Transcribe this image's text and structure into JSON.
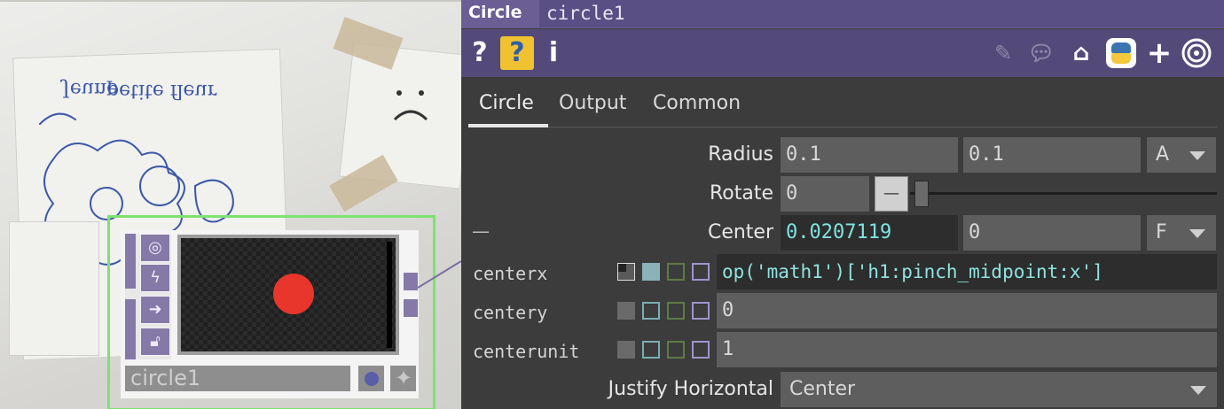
{
  "network": {
    "node": {
      "name": "circle1",
      "wire_color": "#7de26f",
      "dot_color": "#e8362c"
    },
    "sketch_text": [
      "petite fleur",
      "Jeune"
    ]
  },
  "panel": {
    "op_type": "Circle",
    "op_name": "circle1",
    "toolbar": {
      "help": "?",
      "python_help": "?",
      "info": "i",
      "icons_right": [
        "pencil-icon",
        "comment-icon",
        "clipboard-icon",
        "python-icon",
        "plus-icon",
        "target-icon"
      ]
    },
    "tabs": [
      {
        "label": "Circle",
        "active": true
      },
      {
        "label": "Output",
        "active": false
      },
      {
        "label": "Common",
        "active": false
      }
    ],
    "params": {
      "radius": {
        "label": "Radius",
        "x": "0.1",
        "y": "0.1",
        "unit": "A"
      },
      "rotate": {
        "label": "Rotate",
        "value": "0",
        "slider_button": "—"
      },
      "center": {
        "label": "Center",
        "x": "0.0207119",
        "y": "0",
        "unit": "F",
        "collapse": "—"
      },
      "centerx": {
        "label": "centerx",
        "expr": "op('math1')['h1:pinch_midpoint:x']"
      },
      "centery": {
        "label": "centery",
        "value": "0"
      },
      "centerunit": {
        "label": "centerunit",
        "value": "1"
      },
      "justifyh": {
        "label": "Justify Horizontal",
        "value": "Center"
      }
    },
    "colors": {
      "title_bar": "#6a5e94",
      "icon_bar": "#544a7a",
      "active_value": "#7fe3e0"
    }
  }
}
